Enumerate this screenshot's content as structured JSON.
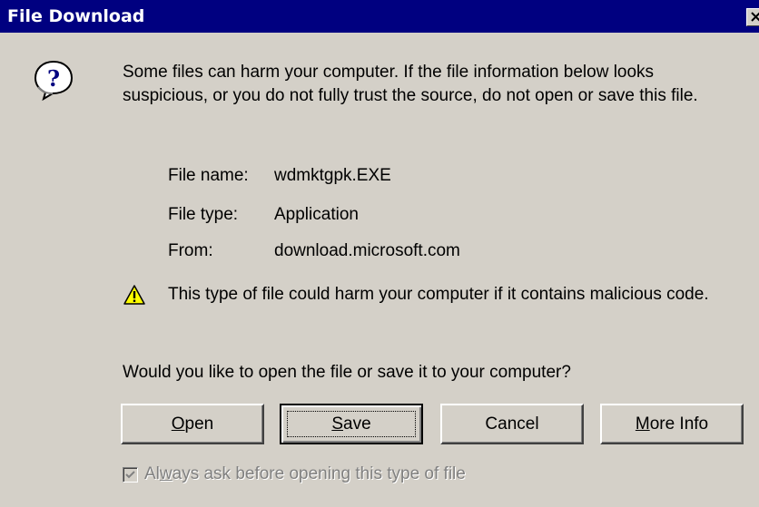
{
  "window": {
    "title": "File Download",
    "close_icon": "close-icon"
  },
  "message": {
    "icon": "question-icon",
    "text": "Some files can harm your computer. If the file information below looks suspicious, or you do not fully trust the source, do not open or save this file."
  },
  "file_info": {
    "name_label": "File name:",
    "name_value": "wdmktgpk.EXE",
    "type_label": "File type:",
    "type_value": "Application",
    "from_label": "From:",
    "from_value": "download.microsoft.com"
  },
  "warning": {
    "icon": "warning-icon",
    "text": "This type of file could harm your computer if it contains malicious code."
  },
  "prompt": "Would you like to open the file or save it to your computer?",
  "buttons": {
    "open": {
      "accel": "O",
      "rest": "pen"
    },
    "save": {
      "accel": "S",
      "rest": "ave"
    },
    "cancel": {
      "label": "Cancel"
    },
    "more_info": {
      "accel": "M",
      "rest": "ore Info"
    }
  },
  "checkbox": {
    "checked": true,
    "disabled": true,
    "prefix": "Al",
    "accel": "w",
    "rest": "ays ask before opening this type of file"
  },
  "colors": {
    "titlebar": "#000080",
    "face": "#d4d0c8",
    "disabled_text": "#808080"
  }
}
